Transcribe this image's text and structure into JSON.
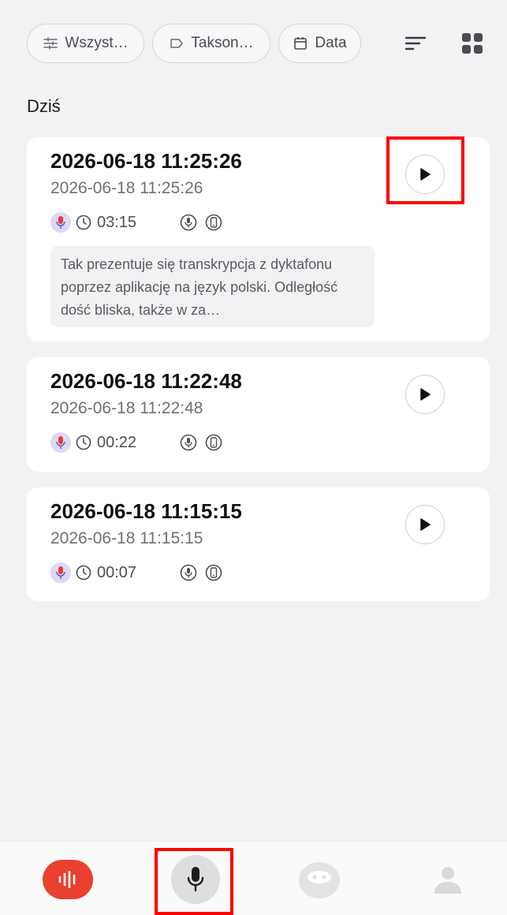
{
  "filters": {
    "all_label": "Wszyst…",
    "taxonomy_label": "Takson…",
    "date_label": "Data"
  },
  "section": {
    "title": "Dziś"
  },
  "recordings": [
    {
      "title": "2026-06-18 11:25:26",
      "subtitle": "2026-06-18 11:25:26",
      "duration": "03:15",
      "transcript": "Tak prezentuje się transkrypcja z dyktafonu poprzez aplikację na język polski. Odległość dość bliska, także w za…"
    },
    {
      "title": "2026-06-18 11:22:48",
      "subtitle": "2026-06-18 11:22:48",
      "duration": "00:22"
    },
    {
      "title": "2026-06-18 11:15:15",
      "subtitle": "2026-06-18 11:15:15",
      "duration": "00:07"
    }
  ],
  "icons": {
    "filter": "sliders-icon",
    "taxonomy": "tag-icon",
    "date": "calendar-icon",
    "sort": "sort-icon",
    "view": "grid-view-icon",
    "play": "play-icon",
    "speaker": "mic-avatar-icon",
    "clock": "clock-icon",
    "source_mic": "microphone-source-icon",
    "source_phone": "phone-source-icon",
    "nav_records": "waveform-icon",
    "nav_record": "microphone-icon",
    "nav_ai": "robot-icon",
    "nav_profile": "person-icon"
  },
  "colors": {
    "accent": "#e9402f",
    "highlight": "#ff0000",
    "card": "#ffffff",
    "background": "#f2f2f4"
  }
}
